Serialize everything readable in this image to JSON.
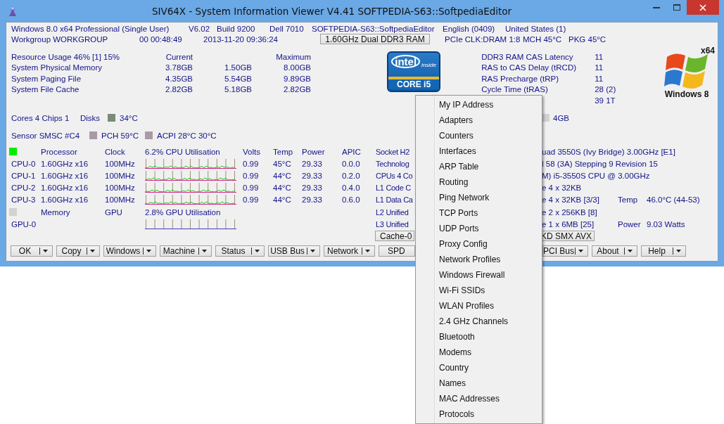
{
  "window": {
    "title": "SIV64X - System Information Viewer V4.41 SOFTPEDIA-S63::SoftpediaEditor"
  },
  "system_line": [
    "Windows 8.0 x64 Professional (Single User)",
    "V6.02",
    "Build 9200",
    "Dell 7010",
    "SOFTPEDIA-S63::SoftpediaEditor",
    "English (0409)",
    "United States (1)"
  ],
  "workgroup_line": {
    "before": [
      "Workgroup WORKGROUP",
      "00 00:48:49",
      "2013-11-20 09:36:24"
    ],
    "memory_button": "1.60GHz Dual DDR3 RAM",
    "after": [
      "PCIe CLK:DRAM 1:8",
      "MCH 45°C",
      "PKG 45°C"
    ]
  },
  "resources": {
    "title": "Resource Usage 46% [1] 15%",
    "current_header": "Current",
    "maximum_header": "Maximum",
    "rows": [
      {
        "label": "System Physical Memory",
        "values": [
          "3.78GB",
          "1.50GB",
          "8.00GB"
        ]
      },
      {
        "label": "System Paging File",
        "values": [
          "4.35GB",
          "5.54GB",
          "9.89GB"
        ]
      },
      {
        "label": "System File Cache",
        "values": [
          "2.82GB",
          "5.18GB",
          "2.82GB"
        ]
      }
    ]
  },
  "intel_badge": {
    "brand": "intel",
    "tag": "inside",
    "model": "CORE i5"
  },
  "memory_timings": [
    {
      "label": "DDR3 RAM CAS Latency",
      "value": "11"
    },
    {
      "label": "RAS to CAS Delay (tRCD)",
      "value": "11"
    },
    {
      "label": "RAS Precharge (tRP)",
      "value": "11"
    },
    {
      "label": "Cycle Time (tRAS)",
      "value": "28 (2)"
    },
    {
      "value": "39 1T"
    }
  ],
  "windows_badge": {
    "arch": "x64",
    "name": "Windows 8"
  },
  "cores_line": {
    "counts": "Cores 4 Chips 1",
    "disks_label": "Disks",
    "disk": {
      "color": "#7b8a7b",
      "reading": "34°C"
    },
    "memory": {
      "color": "#d2d2d2",
      "reading": "4GB"
    }
  },
  "sensor_line": {
    "name": "Sensor SMSC #C4",
    "items": [
      {
        "color": "#a99aa6",
        "reading": "PCH 59°C"
      },
      {
        "color": "#a99aa6",
        "reading": "ACPI 28°C 30°C"
      }
    ]
  },
  "cpu_table": {
    "color": "#00ee00",
    "headers": [
      "Processor",
      "Clock",
      "6.2% CPU Utilisation",
      "Volts",
      "Temp",
      "Power",
      "APIC"
    ],
    "rows": [
      {
        "name": "CPU-0",
        "cells": [
          "1.60GHz x16",
          "100MHz",
          "0.99",
          "45°C",
          "29.33",
          "0.0.0"
        ]
      },
      {
        "name": "CPU-1",
        "cells": [
          "1.60GHz x16",
          "100MHz",
          "0.99",
          "44°C",
          "29.33",
          "0.2.0"
        ]
      },
      {
        "name": "CPU-2",
        "cells": [
          "1.60GHz x16",
          "100MHz",
          "0.99",
          "44°C",
          "29.33",
          "0.4.0"
        ]
      },
      {
        "name": "CPU-3",
        "cells": [
          "1.60GHz x16",
          "100MHz",
          "0.99",
          "44°C",
          "29.33",
          "0.6.0"
        ]
      }
    ]
  },
  "gpu_table": {
    "color": "#d2d2d2",
    "headers": [
      "Memory",
      "GPU",
      "2.8% GPU Utilisation"
    ],
    "rows": [
      {
        "name": "GPU-0"
      }
    ]
  },
  "cpu_details": [
    {
      "left": "Socket H2",
      "right": "uad 3550S (Ivy Bridge) 3.00GHz [E1]"
    },
    {
      "left": "Technolog",
      "right": "l 58 (3A)  Stepping 9  Revision 15"
    },
    {
      "left": "CPUs 4 Co",
      "right": "M) i5-3550S CPU @ 3.00GHz"
    },
    {
      "left": "L1 Code C",
      "right": "e  4 x 32KB"
    },
    {
      "left": "L1 Data Ca",
      "right": "e  4 x 32KB [3/3]",
      "label": "Temp",
      "reading": "46.0°C (44-53)"
    },
    {
      "left": "L2 Unified",
      "right": "e  2 x 256KB [8]"
    },
    {
      "left": "L3 Unified",
      "right": "e  1 x 6MB  [25]",
      "label": "Power",
      "reading": "9.03 Watts"
    }
  ],
  "feature_buttons": [
    "Cache-0",
    "KD SMX AVX"
  ],
  "toolbar": {
    "left": [
      "OK",
      "Copy",
      "Windows",
      "Machine",
      "Status",
      "USB Bus",
      "Network",
      "SPD"
    ],
    "right": [
      "PCI Bus",
      "About",
      "Help"
    ]
  },
  "network_menu": [
    "My IP Address",
    "Adapters",
    "Counters",
    "Interfaces",
    "ARP Table",
    "Routing",
    "Ping Network",
    "TCP Ports",
    "UDP Ports",
    "Proxy Config",
    "Network Profiles",
    "Windows Firewall",
    "Wi-Fi SSIDs",
    "WLAN Profiles",
    "2.4 GHz Channels",
    "Bluetooth",
    "Modems",
    "Country",
    "Names",
    "MAC Addresses",
    "Protocols"
  ]
}
